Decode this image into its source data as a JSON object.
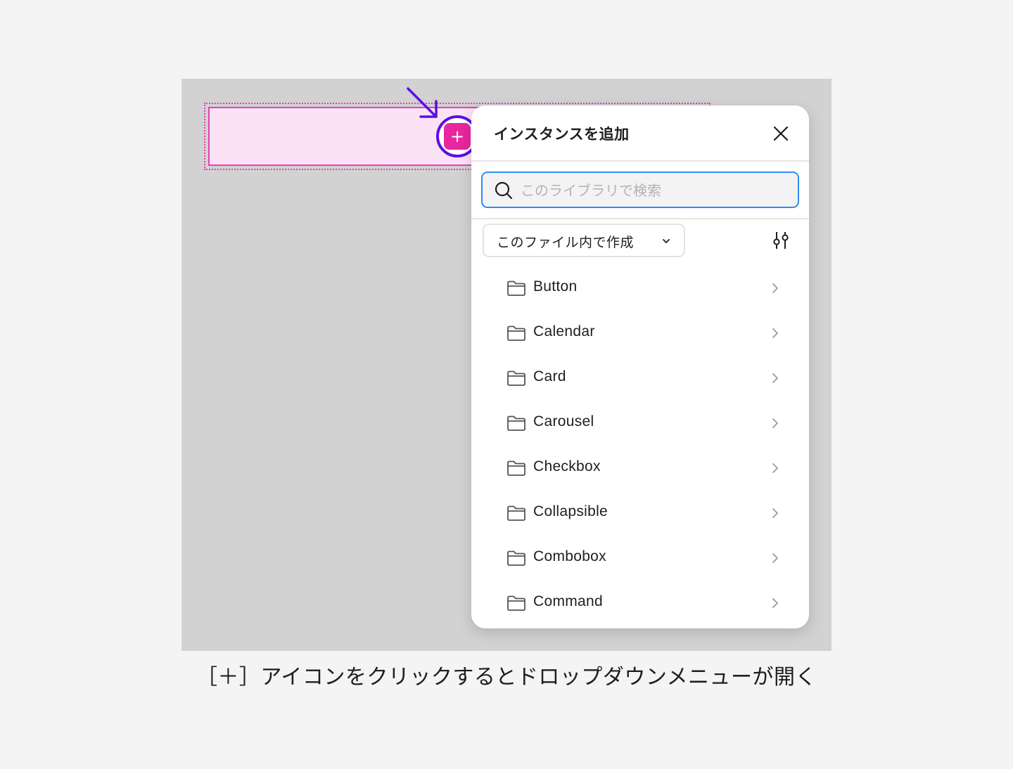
{
  "canvas": {
    "stage_color": "#d2d2d2",
    "selection_color": "#e63fb8",
    "selection_fill": "#fbe3f5",
    "highlight_ring_color": "#5b0fe6"
  },
  "add_button": {
    "label": "+",
    "color": "#e8279f",
    "icon": "plus-icon"
  },
  "panel": {
    "title": "インスタンスを追加",
    "close_icon": "close-icon",
    "search": {
      "placeholder": "このライブラリで検索",
      "value": "",
      "icon": "search-icon",
      "focus_color": "#2f8cf3"
    },
    "source_select": {
      "label": "このファイル内で作成",
      "icon": "chevron-down-icon"
    },
    "filter_icon": "sliders-icon",
    "items": [
      {
        "label": "Button",
        "icon": "folder-icon"
      },
      {
        "label": "Calendar",
        "icon": "folder-icon"
      },
      {
        "label": "Card",
        "icon": "folder-icon"
      },
      {
        "label": "Carousel",
        "icon": "folder-icon"
      },
      {
        "label": "Checkbox",
        "icon": "folder-icon"
      },
      {
        "label": "Collapsible",
        "icon": "folder-icon"
      },
      {
        "label": "Combobox",
        "icon": "folder-icon"
      },
      {
        "label": "Command",
        "icon": "folder-icon"
      }
    ]
  },
  "caption": "［＋］アイコンをクリックするとドロップダウンメニューが開く"
}
